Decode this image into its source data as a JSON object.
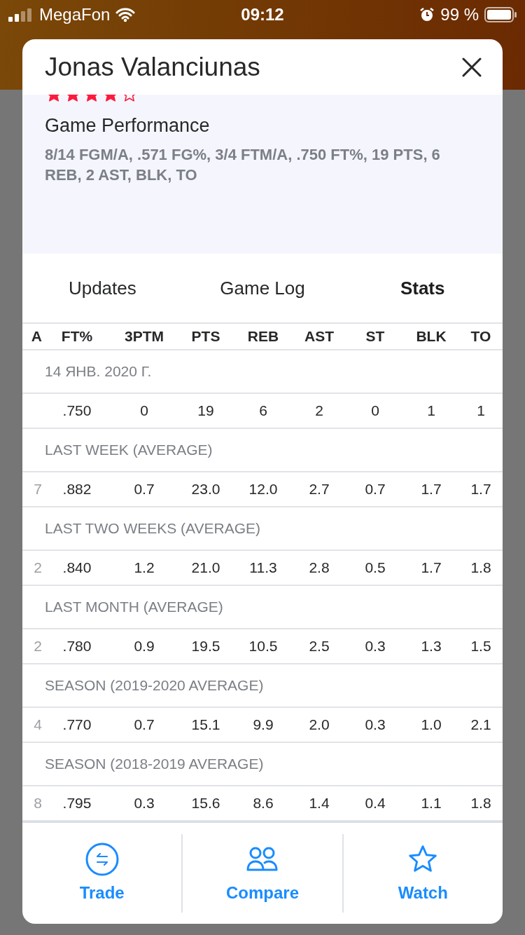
{
  "status_bar": {
    "carrier": "MegaFon",
    "time": "09:12",
    "battery": "99 %"
  },
  "modal": {
    "title": "Jonas Valanciunas",
    "stars": 4,
    "performance_title": "Game Performance",
    "performance_text": "8/14 FGM/A, .571 FG%, 3/4 FTM/A, .750 FT%, 19 PTS, 6 REB, 2 AST, BLK, TO"
  },
  "tabs": [
    {
      "label": "Updates",
      "selected": false
    },
    {
      "label": "Game Log",
      "selected": false
    },
    {
      "label": "Stats",
      "selected": true
    }
  ],
  "table": {
    "columns": [
      "A",
      "FT%",
      "3PTM",
      "PTS",
      "REB",
      "AST",
      "ST",
      "BLK",
      "TO"
    ],
    "sections": [
      {
        "label": "14 ЯНВ. 2020 Г.",
        "row": [
          ".750",
          "0",
          "19",
          "6",
          "2",
          "0",
          "1",
          "1"
        ]
      },
      {
        "label": "LAST WEEK (AVERAGE)",
        "column_1": "7",
        "row": [
          ".882",
          "0.7",
          "23.0",
          "12.0",
          "2.7",
          "0.7",
          "1.7",
          "1.7"
        ]
      },
      {
        "label": "LAST TWO WEEKS (AVERAGE)",
        "column_1": "2",
        "row": [
          ".840",
          "1.2",
          "21.0",
          "11.3",
          "2.8",
          "0.5",
          "1.7",
          "1.8"
        ]
      },
      {
        "label": "LAST MONTH (AVERAGE)",
        "column_1": "2",
        "row": [
          ".780",
          "0.9",
          "19.5",
          "10.5",
          "2.5",
          "0.3",
          "1.3",
          "1.5"
        ]
      },
      {
        "label": "SEASON (2019-2020 AVERAGE)",
        "column_1": "4",
        "row": [
          ".770",
          "0.7",
          "15.1",
          "9.9",
          "2.0",
          "0.3",
          "1.0",
          "2.1"
        ]
      },
      {
        "label": "SEASON (2018-2019 AVERAGE)",
        "column_1": "8",
        "row": [
          ".795",
          "0.3",
          "15.6",
          "8.6",
          "1.4",
          "0.4",
          "1.1",
          "1.8"
        ]
      }
    ]
  },
  "actions": [
    {
      "kind": "trade",
      "label": "Trade"
    },
    {
      "kind": "compare",
      "label": "Compare"
    },
    {
      "kind": "watch",
      "label": "Watch"
    }
  ]
}
